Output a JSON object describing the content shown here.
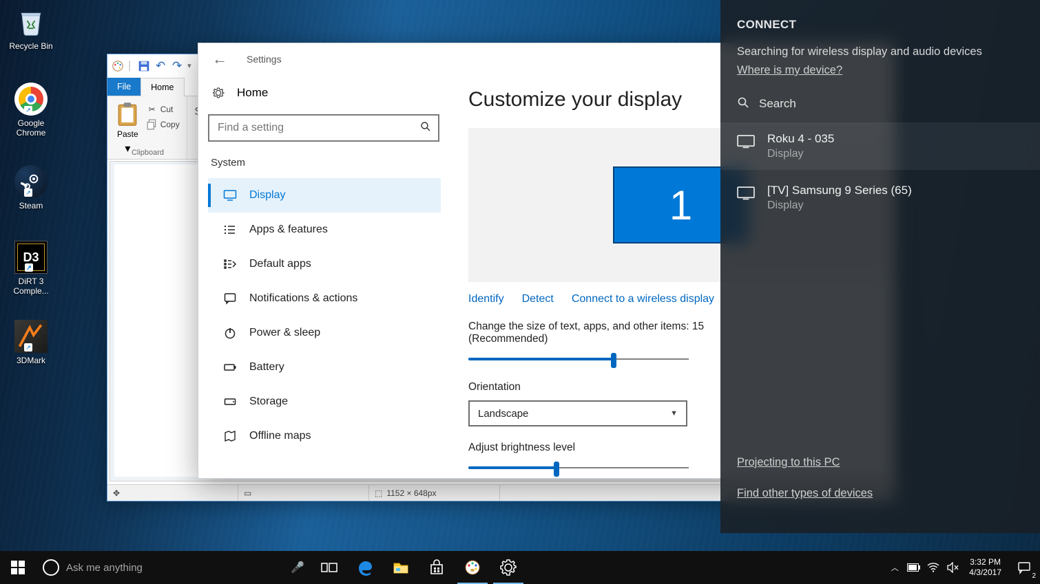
{
  "desktop_icons": {
    "recycle": "Recycle Bin",
    "chrome_l1": "Google",
    "chrome_l2": "Chrome",
    "steam": "Steam",
    "dirt3_l1": "DiRT 3",
    "dirt3_l2": "Comple...",
    "tdm": "3DMark",
    "dirt3_badge": "D3"
  },
  "paint": {
    "tabs": {
      "file": "File",
      "home": "Home"
    },
    "paste": "Paste",
    "cut": "Cut",
    "copy": "Copy",
    "group_clipboard": "Clipboard",
    "status_size": "1152 × 648px"
  },
  "settings": {
    "title": "Settings",
    "home": "Home",
    "search_placeholder": "Find a setting",
    "section": "System",
    "items": {
      "display": "Display",
      "apps": "Apps & features",
      "default_apps": "Default apps",
      "notifications": "Notifications & actions",
      "power": "Power & sleep",
      "battery": "Battery",
      "storage": "Storage",
      "maps": "Offline maps"
    },
    "content": {
      "heading": "Customize your display",
      "monitor_number": "1",
      "identify": "Identify",
      "detect": "Detect",
      "connect_wireless": "Connect to a wireless display",
      "scale_label_pre": "Change the size of text, apps, and other items: 15",
      "scale_label_post": "(Recommended)",
      "orientation_label": "Orientation",
      "orientation_value": "Landscape",
      "brightness_label": "Adjust brightness level"
    }
  },
  "connect": {
    "title": "CONNECT",
    "status": "Searching for wireless display and audio devices",
    "where": "Where is my device?",
    "search_placeholder": "Search",
    "devices": [
      {
        "name": "Roku 4 - 035",
        "type": "Display"
      },
      {
        "name": "[TV] Samsung 9 Series (65)",
        "type": "Display"
      }
    ],
    "projecting": "Projecting to this PC",
    "other_devices": "Find other types of devices"
  },
  "taskbar": {
    "cortana_placeholder": "Ask me anything",
    "time": "3:32 PM",
    "date": "4/3/2017",
    "action_badge": "2"
  }
}
